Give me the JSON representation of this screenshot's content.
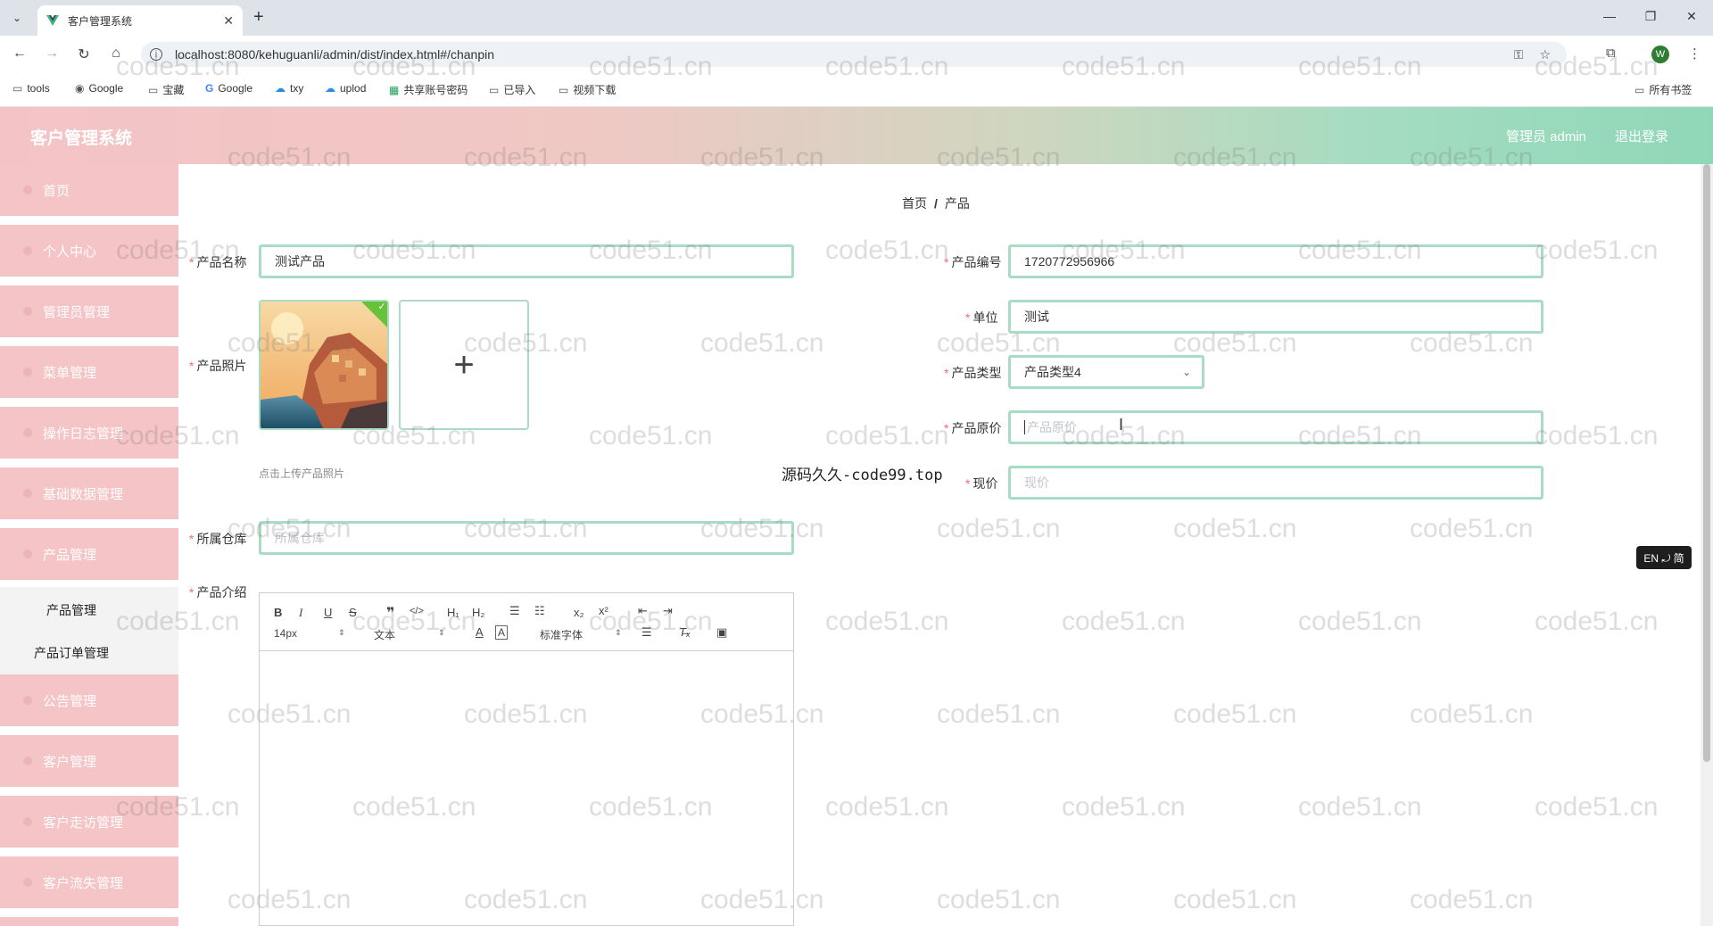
{
  "browser": {
    "tab_title": "客户管理系统",
    "url": "localhost:8080/kehuguanli/admin/dist/index.html#/chanpin",
    "profile_initial": "W",
    "bookmarks": [
      "tools",
      "Google",
      "宝藏",
      "Google",
      "txy",
      "uplod",
      "共享账号密码",
      "已导入",
      "视频下载"
    ],
    "all_bookmarks": "所有书签"
  },
  "header": {
    "title": "客户管理系统",
    "admin": "管理员 admin",
    "logout": "退出登录"
  },
  "sidebar": {
    "items": [
      "首页",
      "个人中心",
      "管理员管理",
      "菜单管理",
      "操作日志管理",
      "基础数据管理",
      "产品管理"
    ],
    "sub_items": [
      "产品管理",
      "产品订单管理"
    ],
    "items_after": [
      "公告管理",
      "客户管理",
      "客户走访管理",
      "客户流失管理"
    ]
  },
  "breadcrumb": {
    "home": "首页",
    "sep": "/",
    "current": "产品"
  },
  "form": {
    "name_label": "产品名称",
    "name_value": "测试产品",
    "code_label": "产品编号",
    "code_value": "1720772956966",
    "unit_label": "单位",
    "unit_value": "测试",
    "photo_label": "产品照片",
    "upload_plus": "+",
    "upload_tip": "点击上传产品照片",
    "type_label": "产品类型",
    "type_value": "产品类型4",
    "orig_price_label": "产品原价",
    "orig_price_placeholder": "产品原价",
    "price_label": "现价",
    "price_placeholder": "现价",
    "warehouse_label": "所属仓库",
    "warehouse_placeholder": "所属仓库",
    "intro_label": "产品介绍"
  },
  "editor": {
    "font_size": "14px",
    "text_type": "文本",
    "font_family": "标准字体"
  },
  "overlay_text": "源码久久-code99.top",
  "lang_toggle": "EN ⤾ 简",
  "watermark": "code51.cn",
  "colors": {
    "accent": "#a8dcc4",
    "sidebar": "#f5c4c6",
    "required": "#f56c6c"
  }
}
